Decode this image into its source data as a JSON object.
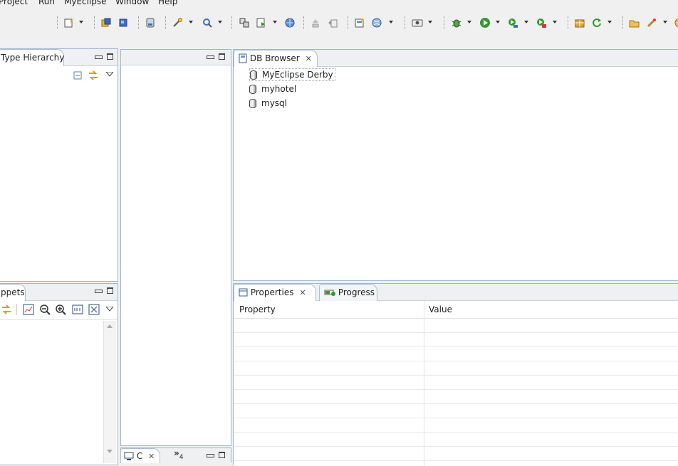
{
  "menu": {
    "items": [
      {
        "label": "Project"
      },
      {
        "label": "Run"
      },
      {
        "label": "MyEclipse"
      },
      {
        "label": "Window"
      },
      {
        "label": "Help"
      }
    ]
  },
  "type_hierarchy": {
    "tab_label": "Type Hierarchy"
  },
  "snippets": {
    "tab_label": "ppets"
  },
  "console_view": {
    "tab_label": "C",
    "overflow_label": "»",
    "overflow_count": "4"
  },
  "db_browser": {
    "tab_label": "DB Browser",
    "connections": [
      {
        "label": "MyEclipse Derby"
      },
      {
        "label": "myhotel"
      },
      {
        "label": "mysql"
      }
    ]
  },
  "properties": {
    "tab_label": "Properties",
    "progress_tab_label": "Progress",
    "columns": [
      "Property",
      "Value"
    ],
    "rows": []
  },
  "colors": {
    "panel_border": "#9eb6cf",
    "selection_outline": "#9aa6b3",
    "background": "#f0f0f0"
  }
}
